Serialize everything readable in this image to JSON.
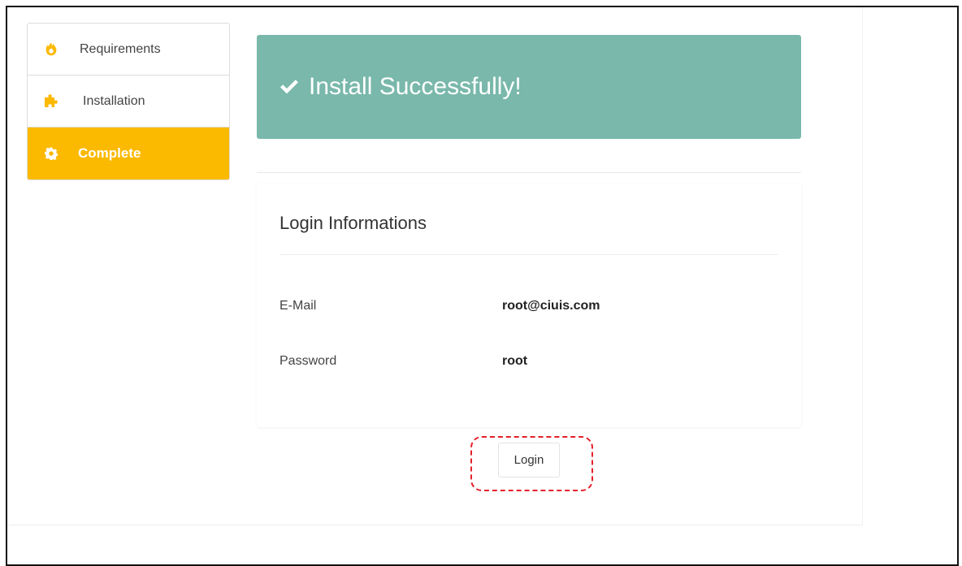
{
  "steps": [
    {
      "label": "Requirements",
      "icon": "fire-icon",
      "active": false
    },
    {
      "label": "Installation",
      "icon": "puzzle-icon",
      "active": false
    },
    {
      "label": "Complete",
      "icon": "gear-icon",
      "active": true
    }
  ],
  "banner": {
    "title": "Install Successfully!",
    "icon": "check-icon"
  },
  "login_info": {
    "title": "Login Informations",
    "email_label": "E-Mail",
    "email_value": "root@ciuis.com",
    "password_label": "Password",
    "password_value": "root"
  },
  "login_button": {
    "label": "Login"
  },
  "colors": {
    "accent": "#fbb900",
    "banner": "#79b8ab",
    "highlight": "#e4202a"
  }
}
